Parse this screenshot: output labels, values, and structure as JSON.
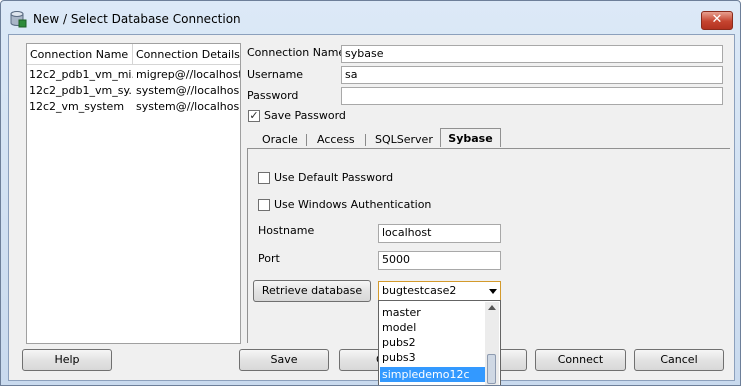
{
  "window": {
    "title": "New / Select Database Connection",
    "close_glyph": "✕",
    "icon": "database-icon"
  },
  "connections": {
    "headers": [
      "Connection Name",
      "Connection Details"
    ],
    "rows": [
      {
        "name": "12c2_pdb1_vm_mi...",
        "details": "migrep@//localhost..."
      },
      {
        "name": "12c2_pdb1_vm_sy...",
        "details": "system@//localhos..."
      },
      {
        "name": "12c2_vm_system",
        "details": "system@//localhos..."
      }
    ]
  },
  "form": {
    "connection_name_label": "Connection Name",
    "connection_name_value": "sybase",
    "username_label": "Username",
    "username_value": "sa",
    "password_label": "Password",
    "password_value": "",
    "save_password_label": "Save Password",
    "save_password_checked": "✓"
  },
  "tabs": [
    {
      "label": "Oracle"
    },
    {
      "label": "Access"
    },
    {
      "label": "SQLServer"
    },
    {
      "label": "Sybase"
    }
  ],
  "sybase": {
    "use_default_password_label": "Use Default Password",
    "use_windows_auth_label": "Use Windows Authentication",
    "hostname_label": "Hostname",
    "hostname_value": "localhost",
    "port_label": "Port",
    "port_value": "5000",
    "retrieve_button": "Retrieve database",
    "database_selected": "bugtestcase2",
    "database_options": [
      "master",
      "model",
      "pubs2",
      "pubs3",
      "simpledemo12c"
    ],
    "highlighted_option": "simpledemo12c"
  },
  "buttons": {
    "help": "Help",
    "save": "Save",
    "clear_partial": "C",
    "connect": "Connect",
    "cancel": "Cancel"
  },
  "colors": {
    "title_gradient": "#dce9f7",
    "selection": "#3399ff",
    "combo_border": "#d39a2c",
    "close_button": "#c5442f"
  }
}
